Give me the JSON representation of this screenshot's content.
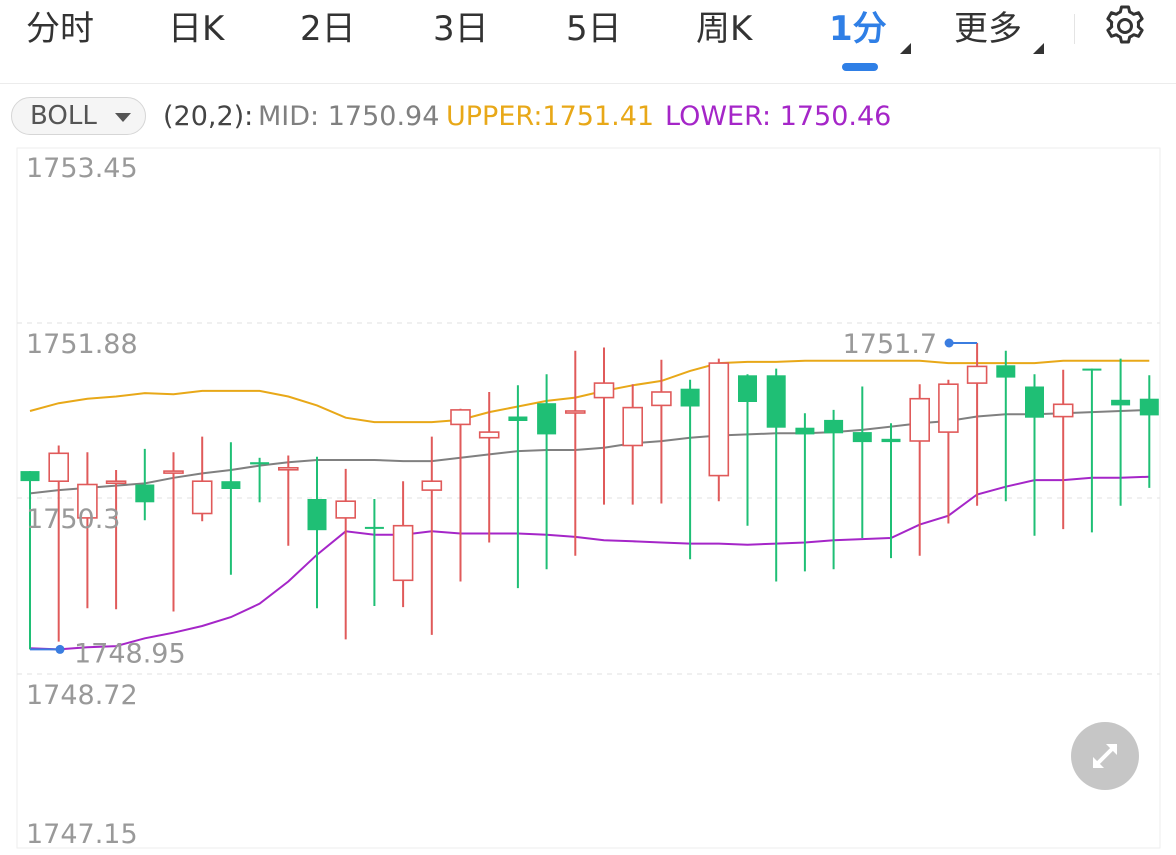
{
  "tabs": {
    "items": [
      {
        "label": "分时",
        "active": false,
        "has_menu": false
      },
      {
        "label": "日K",
        "active": false,
        "has_menu": false
      },
      {
        "label": "2日",
        "active": false,
        "has_menu": false
      },
      {
        "label": "3日",
        "active": false,
        "has_menu": false
      },
      {
        "label": "5日",
        "active": false,
        "has_menu": false
      },
      {
        "label": "周K",
        "active": false,
        "has_menu": false
      },
      {
        "label": "1分",
        "active": true,
        "has_menu": true
      },
      {
        "label": "更多",
        "active": false,
        "has_menu": true
      }
    ],
    "settings_icon": "gear-icon"
  },
  "indicator": {
    "selector_label": "BOLL",
    "params": "(20,2):",
    "mid_text": "MID: 1750.94",
    "upper_text": "UPPER:1751.41",
    "lower_text": "LOWER: 1750.46",
    "colors": {
      "mid": "#808080",
      "upper": "#e8a818",
      "lower": "#a526c8",
      "rise": "#e05a5a",
      "fall": "#1fbf75",
      "marker": "#3b7de0",
      "active_tab": "#2f7fe6"
    }
  },
  "expand_icon": "expand-icon",
  "chart_data": {
    "type": "candlestick",
    "y_axis_labels": [
      "1753.45",
      "1751.88",
      "1750.3",
      "1748.72",
      "1747.15"
    ],
    "ylim": [
      1747.15,
      1753.45
    ],
    "max_marker": {
      "label": "1751.7",
      "value": 1751.7,
      "index": 33
    },
    "min_marker": {
      "label": "1748.95",
      "value": 1748.95,
      "index": 0
    },
    "candles": [
      {
        "o": 1750.55,
        "c": 1750.46,
        "h": 1750.55,
        "l": 1748.95
      },
      {
        "o": 1750.46,
        "c": 1750.71,
        "h": 1750.78,
        "l": 1749.02
      },
      {
        "o": 1750.13,
        "c": 1750.43,
        "h": 1750.72,
        "l": 1749.32
      },
      {
        "o": 1750.46,
        "c": 1750.46,
        "h": 1750.56,
        "l": 1749.31
      },
      {
        "o": 1750.43,
        "c": 1750.27,
        "h": 1750.75,
        "l": 1750.11
      },
      {
        "o": 1750.55,
        "c": 1750.55,
        "h": 1750.72,
        "l": 1749.29
      },
      {
        "o": 1750.17,
        "c": 1750.46,
        "h": 1750.86,
        "l": 1750.1
      },
      {
        "o": 1750.46,
        "c": 1750.39,
        "h": 1750.81,
        "l": 1749.62
      },
      {
        "o": 1750.63,
        "c": 1750.61,
        "h": 1750.67,
        "l": 1750.27
      },
      {
        "o": 1750.57,
        "c": 1750.58,
        "h": 1750.69,
        "l": 1749.88
      },
      {
        "o": 1750.3,
        "c": 1750.02,
        "h": 1750.68,
        "l": 1749.32
      },
      {
        "o": 1750.13,
        "c": 1750.28,
        "h": 1750.57,
        "l": 1749.04
      },
      {
        "o": 1750.05,
        "c": 1750.04,
        "h": 1750.3,
        "l": 1749.34
      },
      {
        "o": 1749.57,
        "c": 1750.06,
        "h": 1750.46,
        "l": 1749.33
      },
      {
        "o": 1750.38,
        "c": 1750.46,
        "h": 1750.86,
        "l": 1749.08
      },
      {
        "o": 1750.97,
        "c": 1751.1,
        "h": 1751.11,
        "l": 1749.56
      },
      {
        "o": 1750.85,
        "c": 1750.9,
        "h": 1751.26,
        "l": 1749.91
      },
      {
        "o": 1751.04,
        "c": 1751.0,
        "h": 1751.32,
        "l": 1749.5
      },
      {
        "o": 1751.16,
        "c": 1750.88,
        "h": 1751.42,
        "l": 1749.67
      },
      {
        "o": 1751.08,
        "c": 1751.09,
        "h": 1751.63,
        "l": 1749.79
      },
      {
        "o": 1751.21,
        "c": 1751.34,
        "h": 1751.66,
        "l": 1750.25
      },
      {
        "o": 1750.78,
        "c": 1751.12,
        "h": 1751.33,
        "l": 1750.25
      },
      {
        "o": 1751.14,
        "c": 1751.26,
        "h": 1751.55,
        "l": 1750.26
      },
      {
        "o": 1751.29,
        "c": 1751.13,
        "h": 1751.37,
        "l": 1749.76
      },
      {
        "o": 1750.51,
        "c": 1751.52,
        "h": 1751.56,
        "l": 1750.28
      },
      {
        "o": 1751.41,
        "c": 1751.17,
        "h": 1751.42,
        "l": 1750.06
      },
      {
        "o": 1751.41,
        "c": 1750.94,
        "h": 1751.47,
        "l": 1749.56
      },
      {
        "o": 1750.94,
        "c": 1750.88,
        "h": 1751.07,
        "l": 1749.65
      },
      {
        "o": 1751.01,
        "c": 1750.89,
        "h": 1751.1,
        "l": 1749.67
      },
      {
        "o": 1750.9,
        "c": 1750.81,
        "h": 1751.31,
        "l": 1749.95
      },
      {
        "o": 1750.84,
        "c": 1750.81,
        "h": 1750.98,
        "l": 1749.77
      },
      {
        "o": 1750.82,
        "c": 1751.2,
        "h": 1751.33,
        "l": 1749.79
      },
      {
        "o": 1750.9,
        "c": 1751.33,
        "h": 1751.37,
        "l": 1750.08
      },
      {
        "o": 1751.34,
        "c": 1751.49,
        "h": 1751.7,
        "l": 1750.24
      },
      {
        "o": 1751.5,
        "c": 1751.39,
        "h": 1751.63,
        "l": 1750.28
      },
      {
        "o": 1751.31,
        "c": 1751.03,
        "h": 1751.42,
        "l": 1749.97
      },
      {
        "o": 1751.04,
        "c": 1751.15,
        "h": 1751.46,
        "l": 1750.03
      },
      {
        "o": 1751.47,
        "c": 1751.46,
        "h": 1751.47,
        "l": 1750.0
      },
      {
        "o": 1751.19,
        "c": 1751.14,
        "h": 1751.56,
        "l": 1750.24
      },
      {
        "o": 1751.2,
        "c": 1751.05,
        "h": 1751.41,
        "l": 1750.4
      }
    ],
    "mid": [
      1750.35,
      1750.38,
      1750.4,
      1750.42,
      1750.44,
      1750.49,
      1750.53,
      1750.56,
      1750.6,
      1750.63,
      1750.65,
      1750.65,
      1750.65,
      1750.64,
      1750.64,
      1750.67,
      1750.7,
      1750.73,
      1750.74,
      1750.74,
      1750.76,
      1750.8,
      1750.82,
      1750.85,
      1750.87,
      1750.88,
      1750.89,
      1750.89,
      1750.9,
      1750.92,
      1750.95,
      1750.98,
      1751.0,
      1751.04,
      1751.06,
      1751.06,
      1751.07,
      1751.08,
      1751.09,
      1751.1
    ],
    "upper": [
      1751.09,
      1751.16,
      1751.2,
      1751.22,
      1751.25,
      1751.24,
      1751.27,
      1751.27,
      1751.27,
      1751.22,
      1751.14,
      1751.03,
      1750.99,
      1750.99,
      1750.99,
      1751.01,
      1751.08,
      1751.13,
      1751.18,
      1751.21,
      1751.27,
      1751.32,
      1751.36,
      1751.45,
      1751.52,
      1751.53,
      1751.53,
      1751.54,
      1751.54,
      1751.54,
      1751.54,
      1751.54,
      1751.52,
      1751.52,
      1751.52,
      1751.52,
      1751.54,
      1751.54,
      1751.54,
      1751.54
    ],
    "lower": [
      1748.96,
      1748.95,
      1748.97,
      1748.98,
      1749.05,
      1749.1,
      1749.16,
      1749.24,
      1749.36,
      1749.56,
      1749.8,
      1750.01,
      1749.98,
      1749.98,
      1750.01,
      1749.99,
      1749.99,
      1749.99,
      1749.98,
      1749.96,
      1749.93,
      1749.92,
      1749.91,
      1749.9,
      1749.9,
      1749.89,
      1749.9,
      1749.91,
      1749.93,
      1749.94,
      1749.95,
      1750.07,
      1750.15,
      1750.34,
      1750.41,
      1750.47,
      1750.47,
      1750.49,
      1750.49,
      1750.5
    ]
  }
}
